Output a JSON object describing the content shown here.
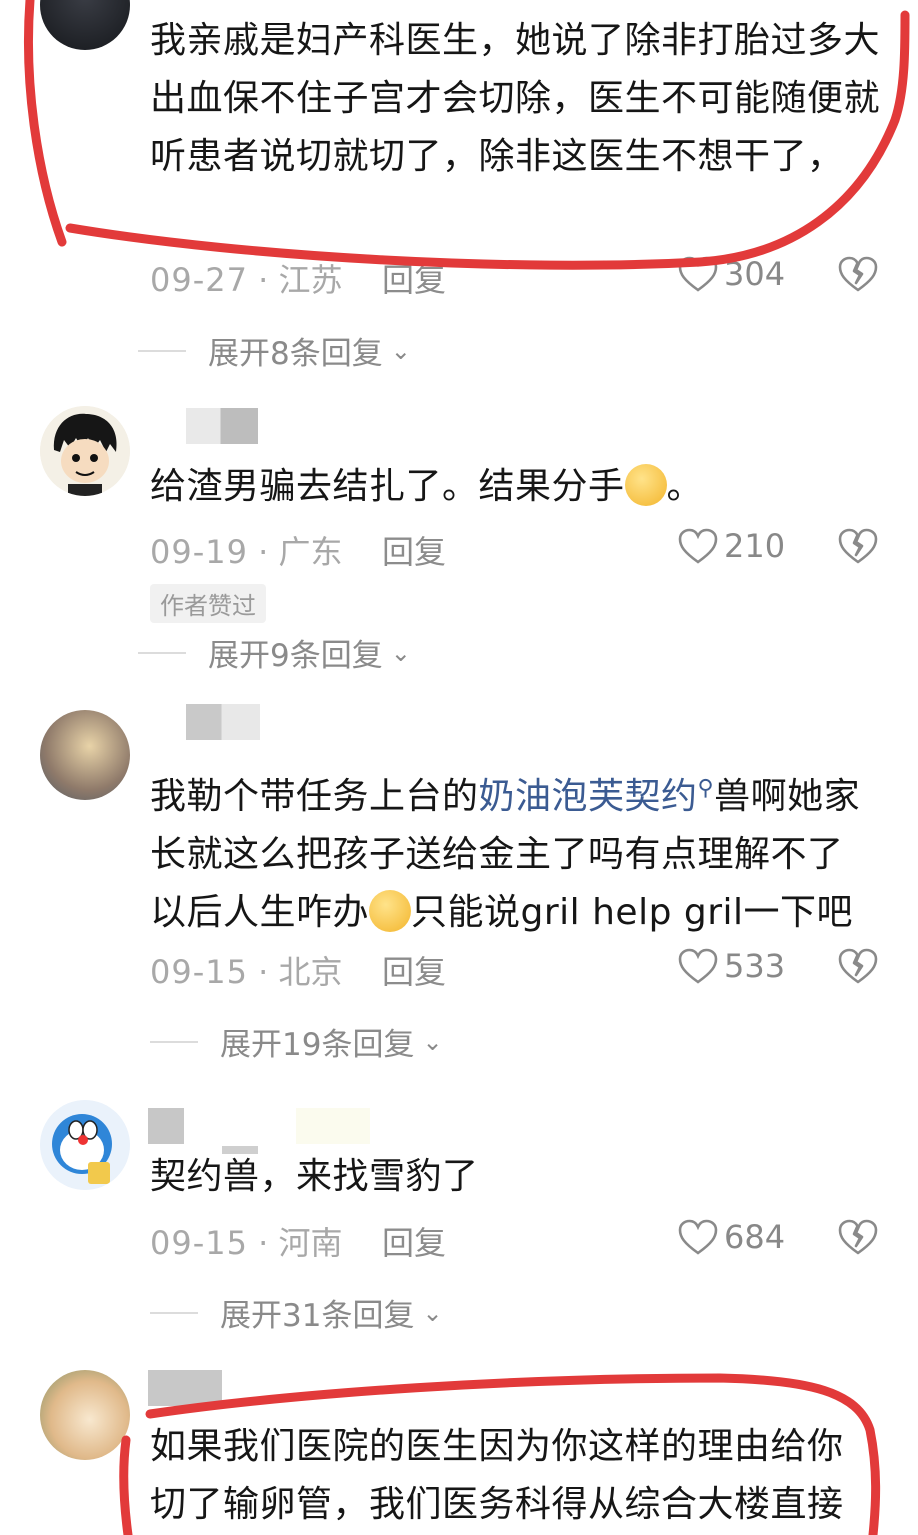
{
  "comments": [
    {
      "text": "我亲戚是妇产科医生，她说了除非打胎过多大出血保不住子宫才会切除，医生不可能随便就听患者说切就切了，除非这医生不想干了，",
      "date": "09-27",
      "region": "江苏",
      "reply_label": "回复",
      "likes": "304",
      "expand_label": "展开8条回复"
    },
    {
      "text_before": "给渣男骗去结扎了。结果分手",
      "text_after": "。",
      "emoji": "facepalm-emoji",
      "date": "09-19",
      "region": "广东",
      "reply_label": "回复",
      "likes": "210",
      "badge": "作者赞过",
      "expand_label": "展开9条回复"
    },
    {
      "text_line1_before": "我勒个带任务上台的",
      "link": "奶油泡芙契约",
      "text_line1_after": "兽啊她家",
      "text_line2": "长就这么把孩子送给金主了吗有点理解不了",
      "text_line3_before": "以后人生咋办",
      "text_line3_after": "只能说gril help gril一下吧",
      "emoji": "grinning-sweat-emoji",
      "date": "09-15",
      "region": "北京",
      "reply_label": "回复",
      "likes": "533",
      "expand_label": "展开19条回复"
    },
    {
      "text": "契约兽，来找雪豹了",
      "date": "09-15",
      "region": "河南",
      "reply_label": "回复",
      "likes": "684",
      "expand_label": "展开31条回复"
    },
    {
      "text_line1": "如果我们医院的医生因为你这样的理由给你",
      "text_line2": "切了输卵管，我们医务科得从综合大楼直接"
    }
  ],
  "separator": " · ",
  "colors": {
    "annotation_red": "#e23a3a",
    "link_blue": "#3b5b92",
    "meta_gray": "#a8a8a8"
  }
}
